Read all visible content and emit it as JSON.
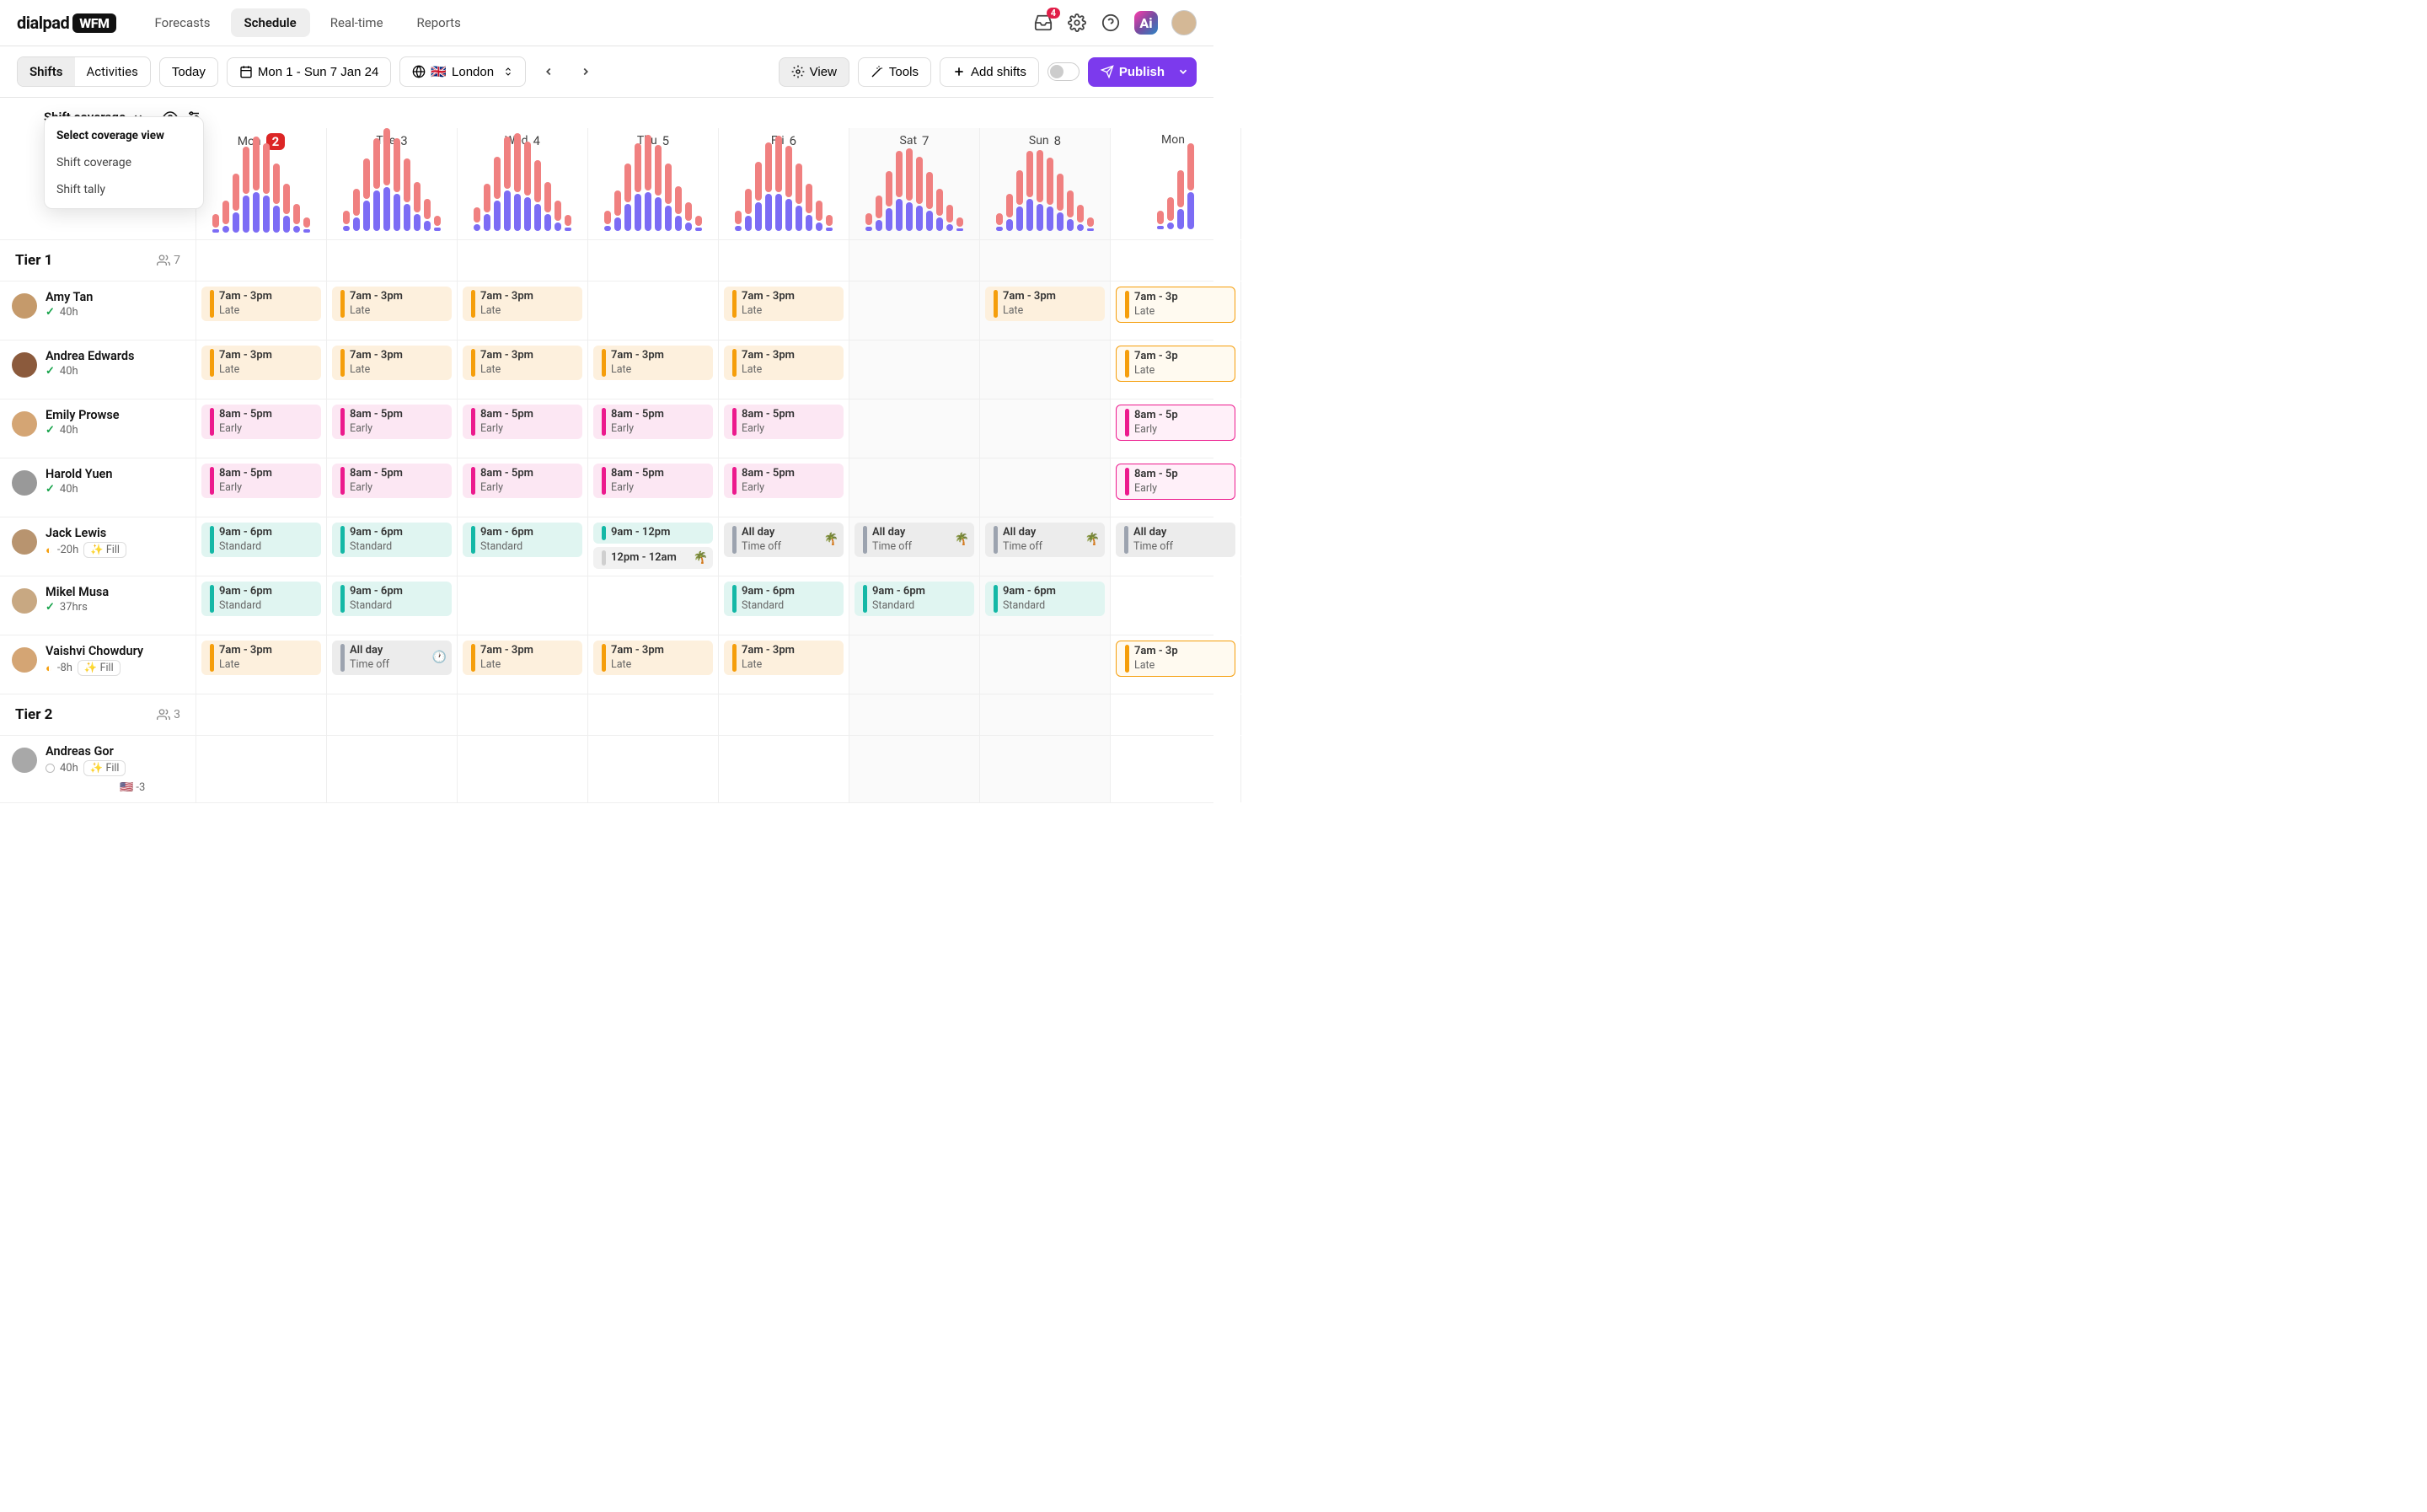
{
  "brand": {
    "name": "dialpad",
    "badge": "WFM"
  },
  "nav": {
    "items": [
      "Forecasts",
      "Schedule",
      "Real-time",
      "Reports"
    ],
    "active": "Schedule"
  },
  "header": {
    "notif_count": "4"
  },
  "toolbar": {
    "segments": [
      "Shifts",
      "Activities"
    ],
    "active_segment": "Shifts",
    "today": "Today",
    "date_range": "Mon 1 - Sun 7 Jan 24",
    "timezone": "London",
    "flag": "🇬🇧",
    "view": "View",
    "tools": "Tools",
    "add_shifts": "Add shifts",
    "publish": "Publish"
  },
  "coverage": {
    "label": "Shift coverage",
    "dropdown": {
      "title": "Select coverage view",
      "items": [
        "Shift coverage",
        "Shift tally"
      ]
    }
  },
  "days": [
    {
      "name": "Mon",
      "num": "2",
      "badge": true,
      "weekend": false
    },
    {
      "name": "Tue",
      "num": "3",
      "badge": false,
      "weekend": false
    },
    {
      "name": "Wed",
      "num": "4",
      "badge": false,
      "weekend": false
    },
    {
      "name": "Thu",
      "num": "5",
      "badge": false,
      "weekend": false
    },
    {
      "name": "Fri",
      "num": "6",
      "badge": false,
      "weekend": false
    },
    {
      "name": "Sat",
      "num": "7",
      "badge": false,
      "weekend": true
    },
    {
      "name": "Sun",
      "num": "8",
      "badge": false,
      "weekend": true
    },
    {
      "name": "Mon",
      "num": "",
      "badge": false,
      "weekend": false
    }
  ],
  "chart_data": {
    "type": "bar",
    "note": "Per-day stacked coverage bars (pink=demand, purple=staffed). Values are relative heights (0-1).",
    "days": [
      {
        "bars": [
          [
            0.2,
            0.05
          ],
          [
            0.35,
            0.1
          ],
          [
            0.55,
            0.3
          ],
          [
            0.7,
            0.55
          ],
          [
            0.8,
            0.6
          ],
          [
            0.75,
            0.55
          ],
          [
            0.6,
            0.4
          ],
          [
            0.45,
            0.25
          ],
          [
            0.3,
            0.1
          ],
          [
            0.15,
            0.05
          ]
        ]
      },
      {
        "bars": [
          [
            0.2,
            0.08
          ],
          [
            0.4,
            0.2
          ],
          [
            0.6,
            0.45
          ],
          [
            0.75,
            0.6
          ],
          [
            0.85,
            0.65
          ],
          [
            0.8,
            0.55
          ],
          [
            0.65,
            0.4
          ],
          [
            0.45,
            0.25
          ],
          [
            0.3,
            0.15
          ],
          [
            0.15,
            0.05
          ]
        ]
      },
      {
        "bars": [
          [
            0.22,
            0.1
          ],
          [
            0.42,
            0.25
          ],
          [
            0.62,
            0.45
          ],
          [
            0.78,
            0.6
          ],
          [
            0.88,
            0.55
          ],
          [
            0.8,
            0.5
          ],
          [
            0.62,
            0.4
          ],
          [
            0.45,
            0.25
          ],
          [
            0.3,
            0.12
          ],
          [
            0.16,
            0.05
          ]
        ]
      },
      {
        "bars": [
          [
            0.2,
            0.08
          ],
          [
            0.38,
            0.2
          ],
          [
            0.58,
            0.4
          ],
          [
            0.72,
            0.55
          ],
          [
            0.82,
            0.58
          ],
          [
            0.75,
            0.5
          ],
          [
            0.6,
            0.38
          ],
          [
            0.42,
            0.22
          ],
          [
            0.28,
            0.12
          ],
          [
            0.15,
            0.05
          ]
        ]
      },
      {
        "bars": [
          [
            0.2,
            0.08
          ],
          [
            0.38,
            0.22
          ],
          [
            0.58,
            0.42
          ],
          [
            0.74,
            0.55
          ],
          [
            0.84,
            0.55
          ],
          [
            0.76,
            0.48
          ],
          [
            0.6,
            0.38
          ],
          [
            0.44,
            0.24
          ],
          [
            0.3,
            0.12
          ],
          [
            0.16,
            0.05
          ]
        ]
      },
      {
        "bars": [
          [
            0.18,
            0.06
          ],
          [
            0.34,
            0.16
          ],
          [
            0.52,
            0.34
          ],
          [
            0.68,
            0.48
          ],
          [
            0.78,
            0.42
          ],
          [
            0.7,
            0.38
          ],
          [
            0.55,
            0.3
          ],
          [
            0.4,
            0.2
          ],
          [
            0.26,
            0.1
          ],
          [
            0.14,
            0.04
          ]
        ]
      },
      {
        "bars": [
          [
            0.18,
            0.06
          ],
          [
            0.34,
            0.18
          ],
          [
            0.52,
            0.36
          ],
          [
            0.68,
            0.48
          ],
          [
            0.78,
            0.4
          ],
          [
            0.7,
            0.36
          ],
          [
            0.55,
            0.28
          ],
          [
            0.4,
            0.18
          ],
          [
            0.26,
            0.1
          ],
          [
            0.14,
            0.04
          ]
        ]
      },
      {
        "bars": [
          [
            0.2,
            0.05
          ],
          [
            0.35,
            0.1
          ],
          [
            0.55,
            0.3
          ],
          [
            0.7,
            0.55
          ]
        ]
      }
    ]
  },
  "tiers": [
    {
      "name": "Tier 1",
      "count": "7",
      "agents": [
        {
          "name": "Amy Tan",
          "status": "check",
          "hours": "40h",
          "avatar": "#c59a6b",
          "shifts": [
            {
              "style": "orange",
              "t1": "7am - 3pm",
              "t2": "Late"
            },
            {
              "style": "orange",
              "t1": "7am - 3pm",
              "t2": "Late"
            },
            {
              "style": "orange",
              "t1": "7am - 3pm",
              "t2": "Late"
            },
            null,
            {
              "style": "orange",
              "t1": "7am - 3pm",
              "t2": "Late"
            },
            null,
            {
              "style": "orange",
              "t1": "7am - 3pm",
              "t2": "Late"
            },
            {
              "style": "orange-outline",
              "t1": "7am - 3p",
              "t2": "Late"
            }
          ]
        },
        {
          "name": "Andrea Edwards",
          "status": "check",
          "hours": "40h",
          "avatar": "#8b5a3c",
          "shifts": [
            {
              "style": "orange",
              "t1": "7am - 3pm",
              "t2": "Late"
            },
            {
              "style": "orange",
              "t1": "7am - 3pm",
              "t2": "Late"
            },
            {
              "style": "orange",
              "t1": "7am - 3pm",
              "t2": "Late"
            },
            {
              "style": "orange",
              "t1": "7am - 3pm",
              "t2": "Late"
            },
            {
              "style": "orange",
              "t1": "7am - 3pm",
              "t2": "Late"
            },
            null,
            null,
            {
              "style": "orange-outline",
              "t1": "7am - 3p",
              "t2": "Late"
            }
          ]
        },
        {
          "name": "Emily Prowse",
          "status": "check",
          "hours": "40h",
          "avatar": "#d4a574",
          "shifts": [
            {
              "style": "pink",
              "t1": "8am - 5pm",
              "t2": "Early"
            },
            {
              "style": "pink",
              "t1": "8am - 5pm",
              "t2": "Early"
            },
            {
              "style": "pink",
              "t1": "8am - 5pm",
              "t2": "Early"
            },
            {
              "style": "pink",
              "t1": "8am - 5pm",
              "t2": "Early"
            },
            {
              "style": "pink",
              "t1": "8am - 5pm",
              "t2": "Early"
            },
            null,
            null,
            {
              "style": "pink-outline",
              "t1": "8am - 5p",
              "t2": "Early"
            }
          ]
        },
        {
          "name": "Harold Yuen",
          "status": "check",
          "hours": "40h",
          "avatar": "#999",
          "shifts": [
            {
              "style": "pink",
              "t1": "8am - 5pm",
              "t2": "Early"
            },
            {
              "style": "pink",
              "t1": "8am - 5pm",
              "t2": "Early"
            },
            {
              "style": "pink",
              "t1": "8am - 5pm",
              "t2": "Early"
            },
            {
              "style": "pink",
              "t1": "8am - 5pm",
              "t2": "Early"
            },
            {
              "style": "pink",
              "t1": "8am - 5pm",
              "t2": "Early"
            },
            null,
            null,
            {
              "style": "pink-outline",
              "t1": "8am - 5p",
              "t2": "Early"
            }
          ]
        },
        {
          "name": "Jack Lewis",
          "status": "partial",
          "hours": "-20h",
          "fill": "Fill",
          "avatar": "#b8946f",
          "shifts": [
            {
              "style": "teal",
              "t1": "9am - 6pm",
              "t2": "Standard"
            },
            {
              "style": "teal",
              "t1": "9am - 6pm",
              "t2": "Standard"
            },
            {
              "style": "teal",
              "t1": "9am - 6pm",
              "t2": "Standard"
            },
            [
              {
                "style": "teal",
                "t1": "9am - 12pm",
                "t2": ""
              },
              {
                "style": "gray-light",
                "t1": "12pm - 12am",
                "t2": "",
                "emoji": "🌴"
              }
            ],
            {
              "style": "gray",
              "t1": "All day",
              "t2": "Time off",
              "emoji": "🌴"
            },
            {
              "style": "gray",
              "t1": "All day",
              "t2": "Time off",
              "emoji": "🌴"
            },
            {
              "style": "gray",
              "t1": "All day",
              "t2": "Time off",
              "emoji": "🌴"
            },
            {
              "style": "gray",
              "t1": "All day",
              "t2": "Time off"
            }
          ]
        },
        {
          "name": "Mikel Musa",
          "status": "check",
          "hours": "37hrs",
          "avatar": "#c8a882",
          "shifts": [
            {
              "style": "teal",
              "t1": "9am - 6pm",
              "t2": "Standard"
            },
            {
              "style": "teal",
              "t1": "9am - 6pm",
              "t2": "Standard"
            },
            null,
            null,
            {
              "style": "teal",
              "t1": "9am - 6pm",
              "t2": "Standard"
            },
            {
              "style": "teal",
              "t1": "9am - 6pm",
              "t2": "Standard"
            },
            {
              "style": "teal",
              "t1": "9am - 6pm",
              "t2": "Standard"
            },
            null
          ]
        },
        {
          "name": "Vaishvi Chowdury",
          "status": "partial",
          "hours": "-8h",
          "fill": "Fill",
          "avatar": "#d4a574",
          "shifts": [
            {
              "style": "orange",
              "t1": "7am - 3pm",
              "t2": "Late"
            },
            {
              "style": "gray",
              "t1": "All day",
              "t2": "Time off",
              "emoji": "🕐"
            },
            {
              "style": "orange",
              "t1": "7am - 3pm",
              "t2": "Late"
            },
            {
              "style": "orange",
              "t1": "7am - 3pm",
              "t2": "Late"
            },
            {
              "style": "orange",
              "t1": "7am - 3pm",
              "t2": "Late"
            },
            null,
            null,
            {
              "style": "orange-outline",
              "t1": "7am - 3p",
              "t2": "Late"
            }
          ]
        }
      ]
    },
    {
      "name": "Tier 2",
      "count": "3",
      "agents": [
        {
          "name": "Andreas Gor",
          "status": "empty",
          "hours": "40h",
          "fill": "Fill",
          "avatar": "#a8a8a8",
          "flag": "🇺🇸 -3",
          "shifts": [
            null,
            null,
            null,
            null,
            null,
            null,
            null,
            null
          ]
        }
      ]
    }
  ]
}
